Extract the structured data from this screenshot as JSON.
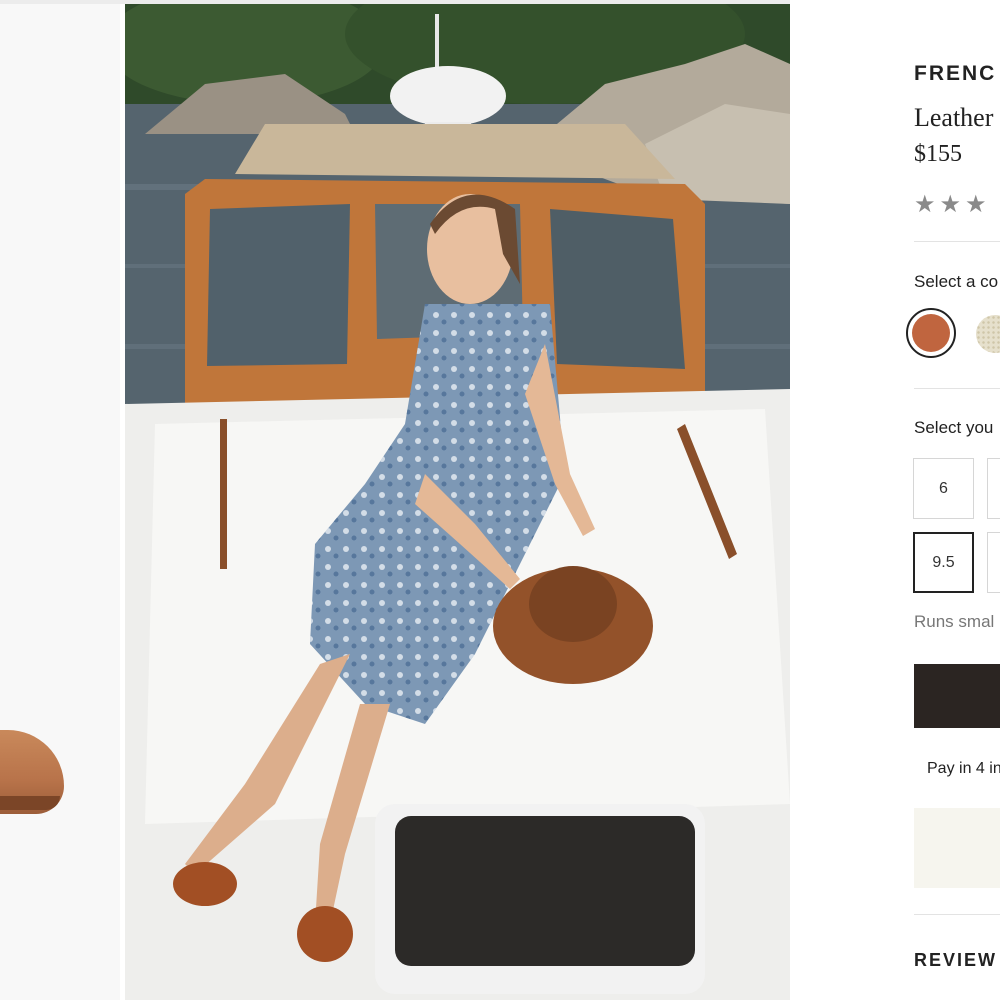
{
  "gallery": {
    "thumbnail_alt": "shoe-thumbnail",
    "main_image": "lifestyle-photo-woman-on-boat"
  },
  "product": {
    "brand": "FRENC",
    "name": "Leather",
    "price": "$155",
    "rating_stars": "★★★",
    "rating_value": 3
  },
  "color": {
    "label": "Select a co",
    "options": [
      {
        "name": "cognac-leather",
        "hex": "#c0653f",
        "selected": true
      },
      {
        "name": "woven-natural",
        "hex": "#e6e0cc",
        "selected": false
      }
    ]
  },
  "size": {
    "label": "Select you",
    "options": [
      {
        "value": "6",
        "selected": false
      },
      {
        "value": "",
        "selected": false
      },
      {
        "value": "9.5",
        "selected": true
      },
      {
        "value": "",
        "selected": false
      }
    ],
    "fit_note": "Runs smal"
  },
  "purchase": {
    "add_to_bag_label": "",
    "pay_note": "Pay in 4 in"
  },
  "reviews": {
    "heading": "REVIEW"
  },
  "colors": {
    "button_dark": "#2b2522",
    "promo_bg": "#f6f5ee",
    "swatch_selected": "#c0653f"
  }
}
